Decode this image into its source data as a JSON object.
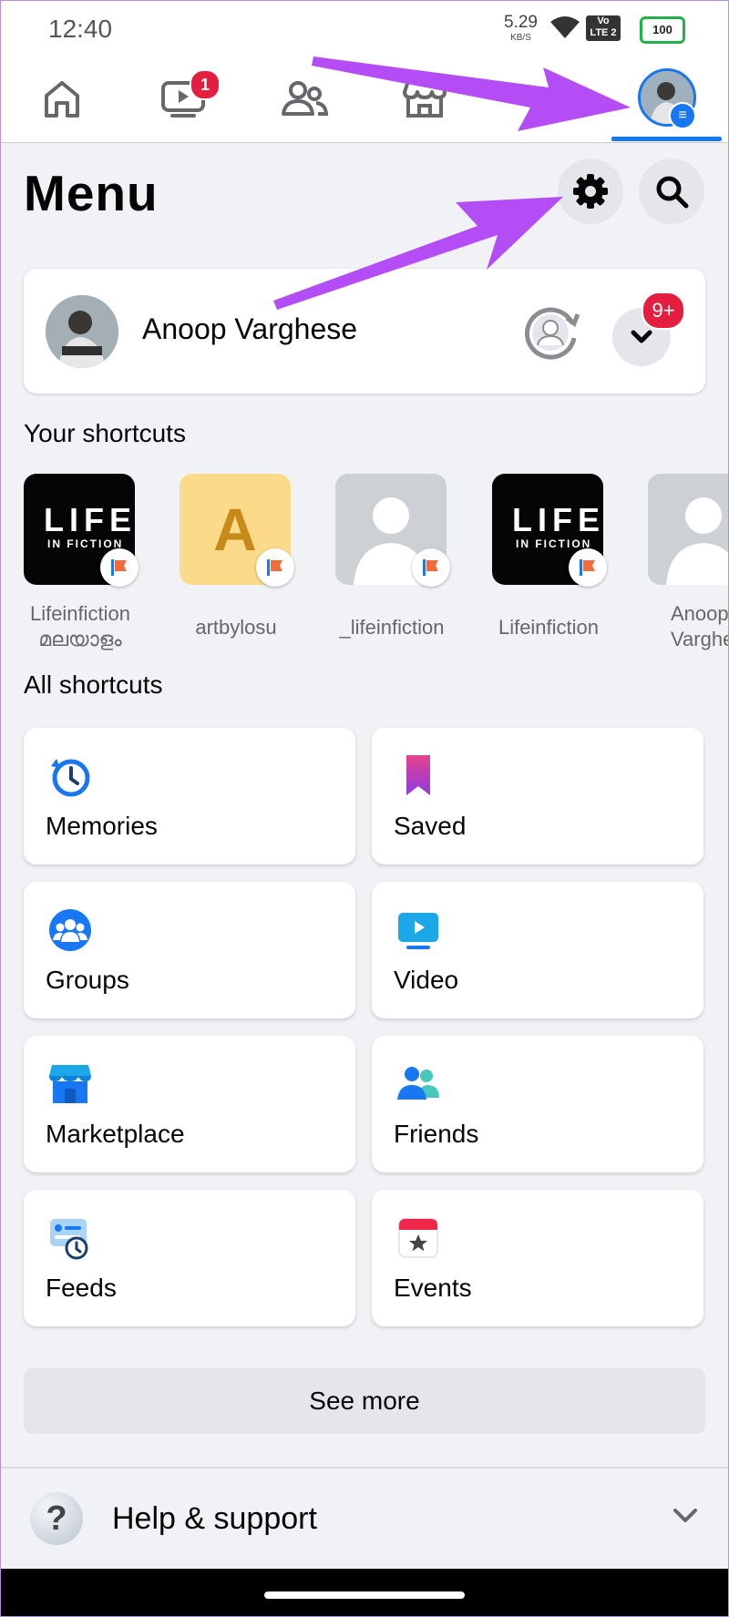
{
  "status_bar": {
    "time": "12:40",
    "net_speed": "5.29",
    "net_unit": "KB/S",
    "volte_line1": "Vo",
    "volte_line2": "LTE 2",
    "battery": "100"
  },
  "nav": {
    "watch_badge": "1"
  },
  "header": {
    "title": "Menu"
  },
  "profile": {
    "name": "Anoop Varghese",
    "notifications_badge": "9+"
  },
  "shortcuts": {
    "title": "Your shortcuts",
    "items": [
      {
        "label": "Lifeinfiction മലയാളം",
        "thumb": "LIFE",
        "thumb_sub": "IN FICTION"
      },
      {
        "label": "artbylosu",
        "thumb": "A"
      },
      {
        "label": "_lifeinfiction",
        "thumb": ""
      },
      {
        "label": "Lifeinfiction",
        "thumb": "LIFE",
        "thumb_sub": "IN FICTION"
      },
      {
        "label": "Anoop Varghe",
        "thumb": ""
      }
    ]
  },
  "all_shortcuts": {
    "title": "All shortcuts",
    "tiles": [
      {
        "label": "Memories",
        "icon": "clock-history-icon"
      },
      {
        "label": "Saved",
        "icon": "bookmark-icon"
      },
      {
        "label": "Groups",
        "icon": "groups-icon"
      },
      {
        "label": "Video",
        "icon": "video-icon"
      },
      {
        "label": "Marketplace",
        "icon": "store-icon"
      },
      {
        "label": "Friends",
        "icon": "friends-icon"
      },
      {
        "label": "Feeds",
        "icon": "feeds-icon"
      },
      {
        "label": "Events",
        "icon": "calendar-star-icon"
      }
    ]
  },
  "see_more": "See more",
  "help": {
    "label": "Help & support",
    "icon_glyph": "?"
  },
  "colors": {
    "accent": "#1877f2",
    "badge": "#e41e3f",
    "annotation_arrow": "#b44df5"
  }
}
